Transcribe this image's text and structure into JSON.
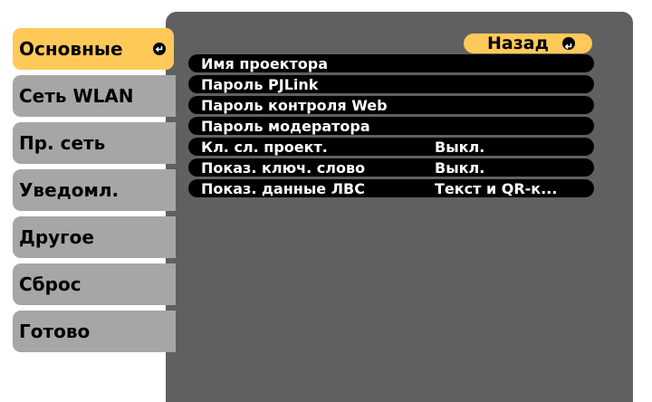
{
  "sidebar": {
    "items": [
      {
        "label": "Основные",
        "active": true
      },
      {
        "label": "Сеть WLAN"
      },
      {
        "label": "Пр. сеть"
      },
      {
        "label": "Уведомл."
      },
      {
        "label": "Другое"
      },
      {
        "label": "Сброс"
      },
      {
        "label": "Готово"
      }
    ]
  },
  "back_button": {
    "label": "Назад"
  },
  "settings": [
    {
      "label": "Имя проектора",
      "value": ""
    },
    {
      "label": "Пароль PJLink",
      "value": ""
    },
    {
      "label": "Пароль контроля Web",
      "value": ""
    },
    {
      "label": "Пароль модератора",
      "value": ""
    },
    {
      "label": "Кл. сл. проект.",
      "value": "Выкл."
    },
    {
      "label": "Показ. ключ. слово",
      "value": "Выкл."
    },
    {
      "label": "Показ. данные ЛВС",
      "value": "Текст и QR-к..."
    }
  ],
  "colors": {
    "accent": "#ffc95a",
    "tab_inactive": "#a6a6a6",
    "panel": "#606060",
    "row": "#000000"
  }
}
